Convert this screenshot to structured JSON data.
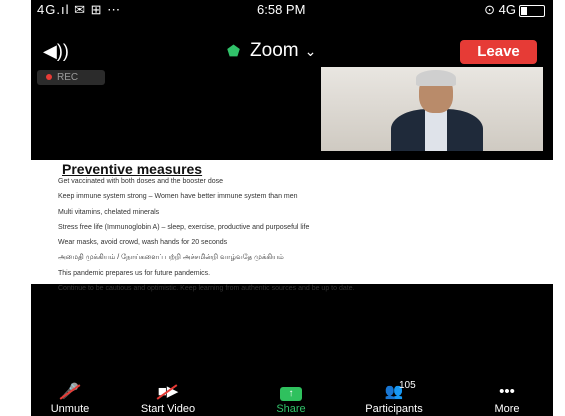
{
  "status_bar": {
    "left": "4G.ıl ✉ ⊞ ⋯",
    "time": "6:58 PM",
    "right": "⊙ 4G"
  },
  "header": {
    "app_title": "Zoom",
    "leave_label": "Leave"
  },
  "recording": {
    "label": "REC"
  },
  "slide": {
    "title": "Preventive measures",
    "items": [
      "Get vaccinated with both doses and the booster dose",
      "Keep immune system strong – Women have better immune system than men",
      "Multi vitamins, chelated minerals",
      "Stress free life (Immunoglobin A) – sleep, exercise, productive and purposeful life",
      "Wear masks, avoid crowd, wash hands for 20 seconds",
      "அமைதி முக்கியம் / நோய்களைப் பற்றி அச்சமின்றி வாழ்வதே முக்கியம்",
      "This pandemic prepares us for future pandemics.",
      "Continue to be cautious and optimistic. Keep learning from authentic sources and be up to date."
    ]
  },
  "toolbar": {
    "unmute_label": "Unmute",
    "start_video_label": "Start Video",
    "share_label": "Share",
    "participants_label": "Participants",
    "participants_count": "105",
    "more_label": "More"
  },
  "colors": {
    "leave_red": "#e63b36",
    "share_green": "#31c26a",
    "background": "#000000"
  },
  "icons": [
    "speaker-icon",
    "shield-icon",
    "chevron-down-icon",
    "mic-muted-icon",
    "video-off-icon",
    "share-arrow-icon",
    "participants-icon",
    "more-dots-icon"
  ]
}
